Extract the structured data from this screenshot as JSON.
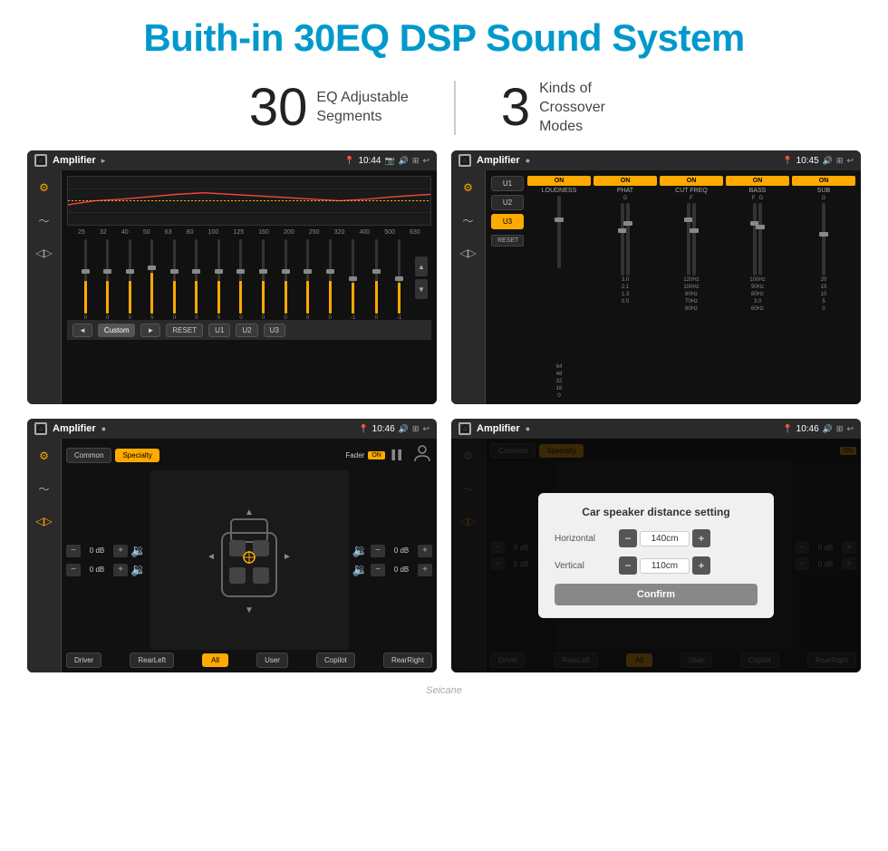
{
  "header": {
    "title": "Buith-in 30EQ DSP Sound System"
  },
  "stats": [
    {
      "number": "30",
      "label": "EQ Adjustable\nSegments"
    },
    {
      "number": "3",
      "label": "Kinds of\nCrossover Modes"
    }
  ],
  "screens": {
    "screen1": {
      "status": {
        "title": "Amplifier",
        "time": "10:44"
      },
      "eq_freqs": [
        "25",
        "32",
        "40",
        "50",
        "63",
        "80",
        "100",
        "125",
        "160",
        "200",
        "250",
        "320",
        "400",
        "500",
        "630"
      ],
      "bottom_buttons": [
        "◄",
        "Custom",
        "►",
        "RESET",
        "U1",
        "U2",
        "U3"
      ]
    },
    "screen2": {
      "status": {
        "title": "Amplifier",
        "time": "10:45"
      },
      "presets": [
        "U1",
        "U2",
        "U3"
      ],
      "active_preset": "U3",
      "channels": [
        "LOUDNESS",
        "PHAT",
        "CUT FREQ",
        "BASS",
        "SUB"
      ],
      "reset_label": "RESET"
    },
    "screen3": {
      "status": {
        "title": "Amplifier",
        "time": "10:46"
      },
      "tabs": [
        "Common",
        "Specialty"
      ],
      "active_tab": "Specialty",
      "fader_label": "Fader",
      "fader_on": "ON",
      "vol_controls": [
        {
          "label": "0 dB"
        },
        {
          "label": "0 dB"
        },
        {
          "label": "0 dB"
        },
        {
          "label": "0 dB"
        }
      ],
      "bottom_buttons": [
        "Driver",
        "RearLeft",
        "All",
        "User",
        "Copilot",
        "RearRight"
      ]
    },
    "screen4": {
      "status": {
        "title": "Amplifier",
        "time": "10:46"
      },
      "dialog": {
        "title": "Car speaker distance setting",
        "rows": [
          {
            "label": "Horizontal",
            "value": "140cm"
          },
          {
            "label": "Vertical",
            "value": "110cm"
          }
        ],
        "confirm_label": "Confirm"
      }
    }
  },
  "footer": {
    "brand": "Seicane"
  }
}
